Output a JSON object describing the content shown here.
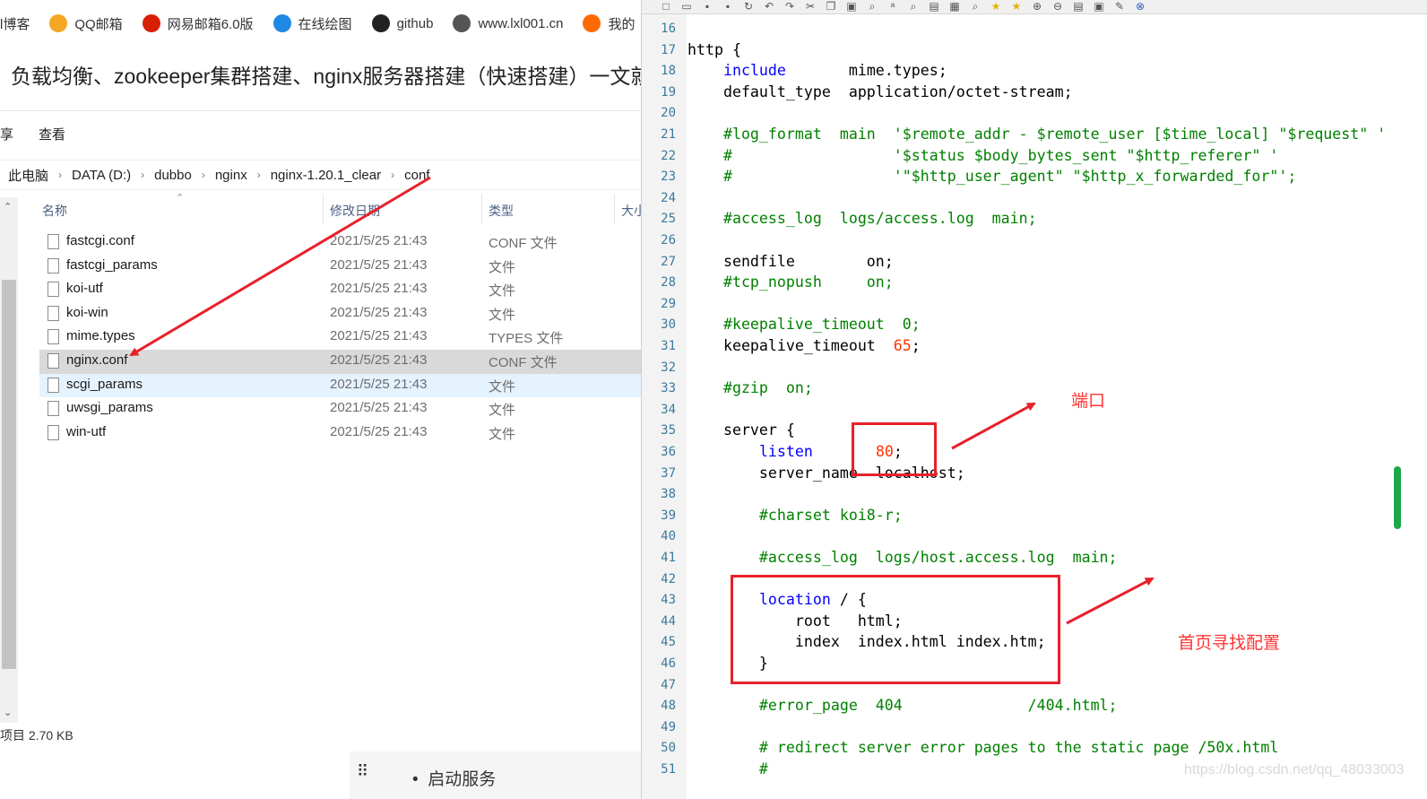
{
  "bookmarks": [
    {
      "label": "l博客",
      "icon": "blog-icon",
      "color": "#ffffff"
    },
    {
      "label": "QQ邮箱",
      "icon": "qq-mail-icon",
      "color": "#f5a623"
    },
    {
      "label": "网易邮箱6.0版",
      "icon": "netease-mail-icon",
      "color": "#d81e06"
    },
    {
      "label": "在线绘图",
      "icon": "processon-icon",
      "color": "#1e88e5"
    },
    {
      "label": "github",
      "icon": "github-icon",
      "color": "#222222"
    },
    {
      "label": "www.lxl001.cn",
      "icon": "globe-icon",
      "color": "#555555"
    },
    {
      "label": "我的",
      "icon": "bookmark-icon",
      "color": "#ff6a00"
    }
  ],
  "article": {
    "title": "负载均衡、zookeeper集群搭建、nginx服务器搭建（快速搭建）一文就够"
  },
  "explorer": {
    "ribbon": {
      "share": "享",
      "view": "查看"
    },
    "breadcrumb": [
      "此电脑",
      "DATA (D:)",
      "dubbo",
      "nginx",
      "nginx-1.20.1_clear",
      "conf"
    ],
    "columns": {
      "name": "名称",
      "date": "修改日期",
      "type": "类型",
      "size": "大小"
    },
    "files": [
      {
        "name": "fastcgi.conf",
        "date": "2021/5/25 21:43",
        "type": "CONF 文件"
      },
      {
        "name": "fastcgi_params",
        "date": "2021/5/25 21:43",
        "type": "文件"
      },
      {
        "name": "koi-utf",
        "date": "2021/5/25 21:43",
        "type": "文件"
      },
      {
        "name": "koi-win",
        "date": "2021/5/25 21:43",
        "type": "文件"
      },
      {
        "name": "mime.types",
        "date": "2021/5/25 21:43",
        "type": "TYPES 文件"
      },
      {
        "name": "nginx.conf",
        "date": "2021/5/25 21:43",
        "type": "CONF 文件"
      },
      {
        "name": "scgi_params",
        "date": "2021/5/25 21:43",
        "type": "文件"
      },
      {
        "name": "uwsgi_params",
        "date": "2021/5/25 21:43",
        "type": "文件"
      },
      {
        "name": "win-utf",
        "date": "2021/5/25 21:43",
        "type": "文件"
      }
    ],
    "status": "项目 2.70 KB"
  },
  "page_bottom": {
    "bullet_text": "启动服务"
  },
  "editor": {
    "lines": [
      {
        "n": "16",
        "t": ""
      },
      {
        "n": "17",
        "t": "http {"
      },
      {
        "n": "18",
        "t": "    include       mime.types;"
      },
      {
        "n": "19",
        "t": "    default_type  application/octet-stream;"
      },
      {
        "n": "20",
        "t": ""
      },
      {
        "n": "21",
        "t": "    #log_format  main  '$remote_addr - $remote_user [$time_local] \"$request\" '"
      },
      {
        "n": "22",
        "t": "    #                  '$status $body_bytes_sent \"$http_referer\" '"
      },
      {
        "n": "23",
        "t": "    #                  '\"$http_user_agent\" \"$http_x_forwarded_for\"';"
      },
      {
        "n": "24",
        "t": ""
      },
      {
        "n": "25",
        "t": "    #access_log  logs/access.log  main;"
      },
      {
        "n": "26",
        "t": ""
      },
      {
        "n": "27",
        "t": "    sendfile        on;"
      },
      {
        "n": "28",
        "t": "    #tcp_nopush     on;"
      },
      {
        "n": "29",
        "t": ""
      },
      {
        "n": "30",
        "t": "    #keepalive_timeout  0;"
      },
      {
        "n": "31",
        "t": "    keepalive_timeout  65;"
      },
      {
        "n": "32",
        "t": ""
      },
      {
        "n": "33",
        "t": "    #gzip  on;"
      },
      {
        "n": "34",
        "t": ""
      },
      {
        "n": "35",
        "t": "    server {"
      },
      {
        "n": "36",
        "t": "        listen       80;"
      },
      {
        "n": "37",
        "t": "        server_name  localhost;"
      },
      {
        "n": "38",
        "t": ""
      },
      {
        "n": "39",
        "t": "        #charset koi8-r;"
      },
      {
        "n": "40",
        "t": ""
      },
      {
        "n": "41",
        "t": "        #access_log  logs/host.access.log  main;"
      },
      {
        "n": "42",
        "t": ""
      },
      {
        "n": "43",
        "t": "        location / {"
      },
      {
        "n": "44",
        "t": "            root   html;"
      },
      {
        "n": "45",
        "t": "            index  index.html index.htm;"
      },
      {
        "n": "46",
        "t": "        }"
      },
      {
        "n": "47",
        "t": ""
      },
      {
        "n": "48",
        "t": "        #error_page  404              /404.html;"
      },
      {
        "n": "49",
        "t": ""
      },
      {
        "n": "50",
        "t": "        # redirect server error pages to the static page /50x.html"
      },
      {
        "n": "51",
        "t": "        #"
      }
    ],
    "keywords": [
      "include",
      "listen",
      "location"
    ]
  },
  "annotations": {
    "port": "端口",
    "index_config": "首页寻找配置"
  },
  "watermark": "https://blog.csdn.net/qq_48033003",
  "colors": {
    "annotation_red": "#e8202a",
    "keyword_blue": "#0000ff",
    "comment_green": "#008000",
    "number_red": "#ff3300",
    "selection_gray": "#d9d9d9"
  }
}
